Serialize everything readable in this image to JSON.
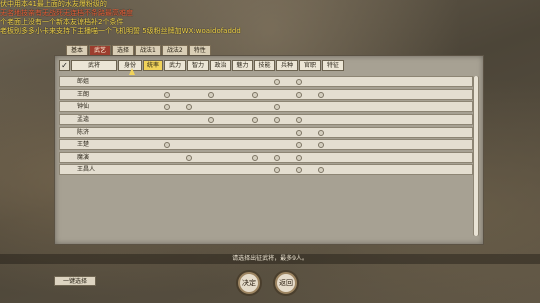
{
  "overlay_lines": [
    "伏中用本41最上面的水友爆粉级的",
    "无名地技亲有无战死无连档不条路最高难度",
    "个老面上没有一个新本友谅档补2个条件",
    "老板别多多小卡来支持下主播喵一个飞机明誓 5级粉丝牌加WX:woaidofaddd"
  ],
  "tabs": [
    "基本",
    "武艺",
    "选择",
    "战法1",
    "战法2",
    "特性"
  ],
  "active_tab": "武艺",
  "header_columns": [
    "武将",
    "身份",
    "统率",
    "武力",
    "智力",
    "政治",
    "魅力",
    "技能",
    "兵种",
    "官职",
    "特征"
  ],
  "header_selected": "统率",
  "header_check_symbol": "✓",
  "rows": [
    {
      "label": "郎姐",
      "circles": [
        6,
        7
      ]
    },
    {
      "label": "王朗",
      "circles": [
        1,
        3,
        5,
        7,
        8
      ]
    },
    {
      "label": "钟仙",
      "circles": [
        1,
        2,
        6
      ]
    },
    {
      "label": "孟逵",
      "circles": [
        3,
        5,
        6,
        7
      ]
    },
    {
      "label": "陈济",
      "circles": [
        7,
        8
      ]
    },
    {
      "label": "王楚",
      "circles": [
        1,
        7,
        8
      ]
    },
    {
      "label": "魔演",
      "circles": [
        2,
        5,
        6,
        7
      ]
    },
    {
      "label": "王昌人",
      "circles": [
        6,
        7,
        8
      ]
    }
  ],
  "status_text": "请选择出征武将，最多9人。",
  "one_click_label": "一键选择",
  "confirm_label": "决定",
  "back_label": "返回"
}
